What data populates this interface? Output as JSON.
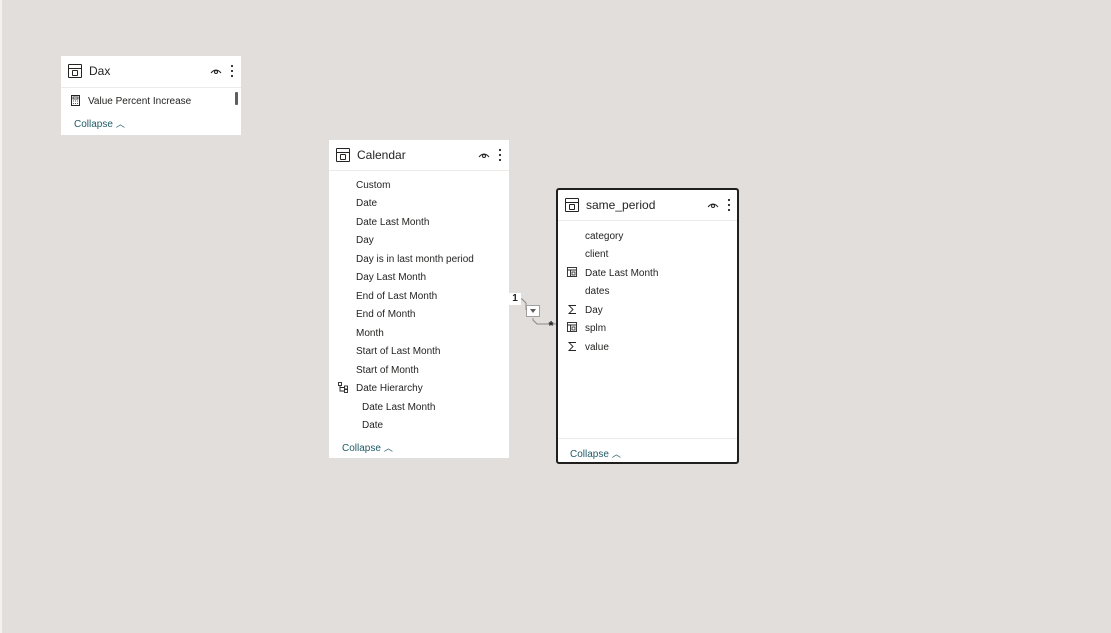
{
  "tables": {
    "dax": {
      "title": "Dax",
      "fields": [
        "Value Percent Increase"
      ],
      "collapse_label": "Collapse"
    },
    "calendar": {
      "title": "Calendar",
      "fields": [
        "Custom",
        "Date",
        "Date Last Month",
        "Day",
        "Day is in last month period",
        "Day Last Month",
        "End of Last Month",
        "End of Month",
        "Month",
        "Start of Last Month",
        "Start of Month",
        "Date Hierarchy",
        "Date Last Month",
        "Date"
      ],
      "collapse_label": "Collapse"
    },
    "same_period": {
      "title": "same_period",
      "fields": [
        "category",
        "client",
        "Date Last Month",
        "dates",
        "Day",
        "splm",
        "value"
      ],
      "collapse_label": "Collapse"
    }
  },
  "relationship": {
    "from_cardinality": "1",
    "to_cardinality": "*"
  },
  "icons": {
    "table": "table-icon",
    "visibility": "eye-icon",
    "more": "more-options-icon",
    "measure": "calculator-icon",
    "sum": "sigma-icon",
    "hierarchy": "hierarchy-icon",
    "calculated_column": "calculated-column-icon",
    "cross_filter": "filter-direction-icon"
  },
  "colors": {
    "canvas": "#e1dedb",
    "card": "#ffffff",
    "text": "#252423",
    "link": "#1f5a66",
    "selected_border": "#201f1e"
  }
}
